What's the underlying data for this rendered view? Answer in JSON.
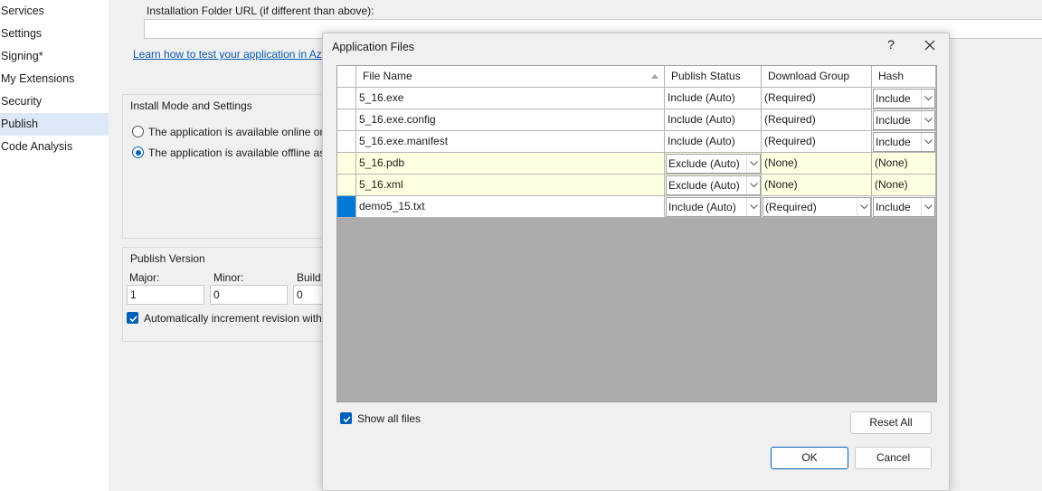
{
  "sidebar": {
    "items": [
      {
        "label": "Services",
        "active": false
      },
      {
        "label": "Settings",
        "active": false
      },
      {
        "label": "Signing*",
        "active": false
      },
      {
        "label": "My Extensions",
        "active": false
      },
      {
        "label": "Security",
        "active": false
      },
      {
        "label": "Publish",
        "active": true
      },
      {
        "label": "Code Analysis",
        "active": false
      }
    ]
  },
  "publish": {
    "install_folder_label": "Installation Folder URL (if different than above):",
    "install_folder_value": "",
    "learn_link": "Learn how to test your application in Az",
    "install_mode": {
      "title": "Install Mode and Settings",
      "online_option": "The application is available online on",
      "offline_option": "The application is available offline as"
    },
    "version": {
      "title": "Publish Version",
      "major_label": "Major:",
      "minor_label": "Minor:",
      "build_label": "Build:",
      "major_value": "1",
      "minor_value": "0",
      "build_value": "0",
      "auto_increment_label": "Automatically increment revision with"
    }
  },
  "dialog": {
    "title": "Application Files",
    "help_label": "?",
    "grid": {
      "columns": [
        "File Name",
        "Publish Status",
        "Download Group",
        "Hash"
      ],
      "rows": [
        {
          "file": "5_16.exe",
          "status": "Include (Auto)",
          "group": "(Required)",
          "hash": "Include"
        },
        {
          "file": "5_16.exe.config",
          "status": "Include (Auto)",
          "group": "(Required)",
          "hash": "Include"
        },
        {
          "file": "5_16.exe.manifest",
          "status": "Include (Auto)",
          "group": "(Required)",
          "hash": "Include"
        },
        {
          "file": "5_16.pdb",
          "status": "Exclude (Auto)",
          "group": "(None)",
          "hash": "(None)"
        },
        {
          "file": "5_16.xml",
          "status": "Exclude (Auto)",
          "group": "(None)",
          "hash": "(None)"
        },
        {
          "file": "demo5_15.txt",
          "status": "Include (Auto)",
          "group": "(Required)",
          "hash": "Include"
        }
      ]
    },
    "show_all_files_label": "Show all files",
    "reset_all_label": "Reset All",
    "ok_label": "OK",
    "cancel_label": "Cancel"
  },
  "colors": {
    "accent": "#005fb8",
    "excluded_row": "#ffffe1",
    "selected_row_header": "#0078d7",
    "grid_empty": "#ababab"
  }
}
